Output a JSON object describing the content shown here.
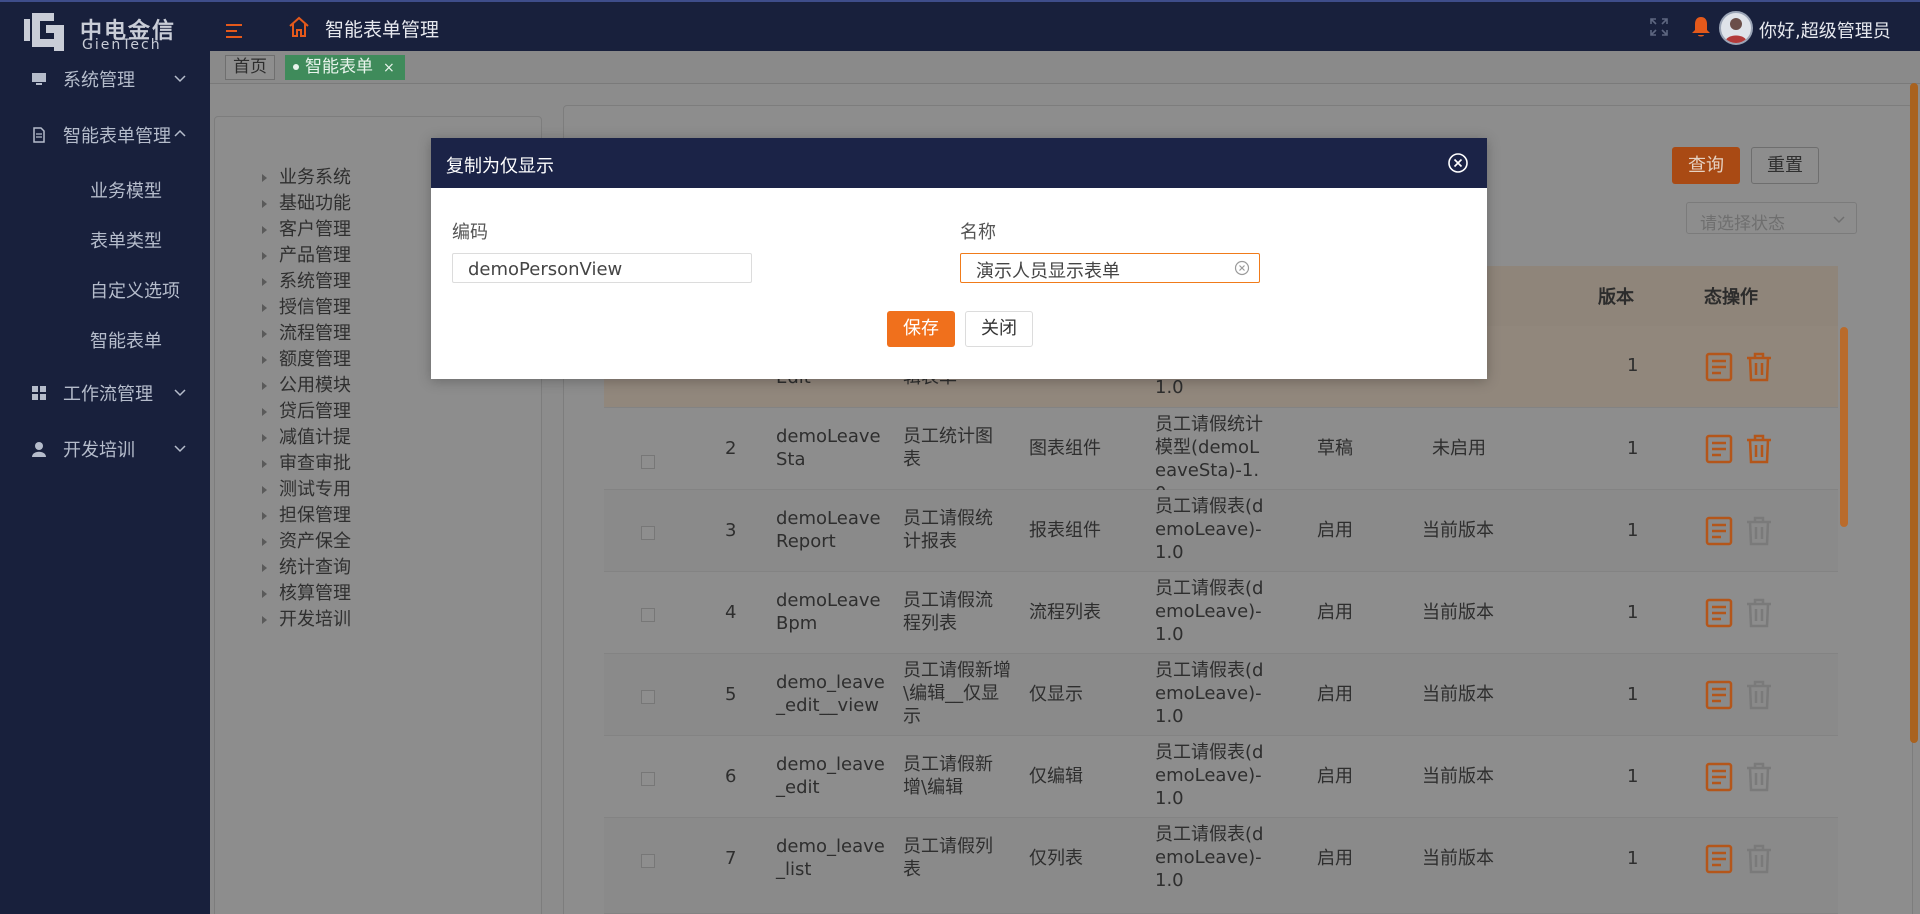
{
  "header": {
    "logo_cn": "中电金信",
    "logo_en": "GienTech",
    "title": "智能表单管理",
    "greeting": "你好,超级管理员"
  },
  "sidebar": {
    "groups": [
      {
        "label": "系统管理",
        "icon": "monitor-icon"
      },
      {
        "label": "智能表单管理",
        "icon": "document-icon"
      },
      {
        "label": "工作流管理",
        "icon": "grid-icon"
      },
      {
        "label": "开发培训",
        "icon": "user-icon"
      }
    ],
    "sub_items": [
      "业务模型",
      "表单类型",
      "自定义选项",
      "智能表单"
    ]
  },
  "tabs": {
    "home": "首页",
    "active": "智能表单",
    "close": "×"
  },
  "tree": [
    "业务系统",
    "基础功能",
    "客户管理",
    "产品管理",
    "系统管理",
    "授信管理",
    "流程管理",
    "额度管理",
    "公用模块",
    "贷后管理",
    "减值计提",
    "审查审批",
    "测试专用",
    "担保管理",
    "资产保全",
    "统计查询",
    "核算管理",
    "开发培训"
  ],
  "filters": {
    "status_placeholder": "请选择状态",
    "query": "查询",
    "reset": "重置"
  },
  "table": {
    "headers": {
      "status": "态",
      "version": "版本",
      "ops": "操作"
    },
    "rows": [
      {
        "no": "",
        "code": "Edit",
        "name": "辑表单",
        "type": "",
        "model": "1.0",
        "state": "",
        "vstate": "",
        "version": "1"
      },
      {
        "no": "2",
        "code": "demoLeaveSta",
        "name": "员工统计图表",
        "type": "图表组件",
        "model": "员工请假统计模型(demoLeaveSta)-1.0",
        "state": "草稿",
        "vstate": "未启用",
        "version": "1"
      },
      {
        "no": "3",
        "code": "demoLeaveReport",
        "name": "员工请假统计报表",
        "type": "报表组件",
        "model": "员工请假表(demoLeave)-1.0",
        "state": "启用",
        "vstate": "当前版本",
        "version": "1"
      },
      {
        "no": "4",
        "code": "demoLeaveBpm",
        "name": "员工请假流程列表",
        "type": "流程列表",
        "model": "员工请假表(demoLeave)-1.0",
        "state": "启用",
        "vstate": "当前版本",
        "version": "1"
      },
      {
        "no": "5",
        "code": "demo_leave_edit__view",
        "name": "员工请假新增\\编辑__仅显示",
        "type": "仅显示",
        "model": "员工请假表(demoLeave)-1.0",
        "state": "启用",
        "vstate": "当前版本",
        "version": "1"
      },
      {
        "no": "6",
        "code": "demo_leave_edit",
        "name": "员工请假新增\\编辑",
        "type": "仅编辑",
        "model": "员工请假表(demoLeave)-1.0",
        "state": "启用",
        "vstate": "当前版本",
        "version": "1"
      },
      {
        "no": "7",
        "code": "demo_leave_list",
        "name": "员工请假列表",
        "type": "仅列表",
        "model": "员工请假表(demoLeave)-1.0",
        "state": "启用",
        "vstate": "当前版本",
        "version": "1"
      }
    ]
  },
  "modal": {
    "title": "复制为仅显示",
    "code_label": "编码",
    "code_value": "demoPersonView",
    "name_label": "名称",
    "name_value": "演示人员显示表单",
    "save": "保存",
    "close": "关闭"
  },
  "colors": {
    "accent": "#f0701c",
    "header_bg": "#18203c",
    "tab_active": "#3f8b5b"
  }
}
